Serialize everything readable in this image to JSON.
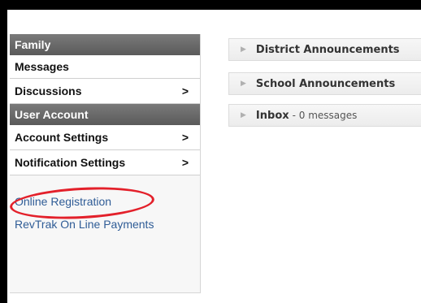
{
  "sidebar": {
    "family_header": "Family",
    "messages": "Messages",
    "discussions": "Discussions",
    "user_account_header": "User Account",
    "account_settings": "Account Settings",
    "notification_settings": "Notification Settings",
    "chevron": ">",
    "links": {
      "online_registration": "Online Registration",
      "revtrak": "RevTrak On Line Payments"
    }
  },
  "panels": {
    "district": {
      "title": "District Announcements"
    },
    "school": {
      "title": "School Announcements"
    },
    "inbox": {
      "title": "Inbox",
      "meta": "- 0 messages"
    }
  },
  "colors": {
    "accent_link": "#2f5c96",
    "highlight_circle": "#e3202a",
    "section_header": "#666666"
  }
}
